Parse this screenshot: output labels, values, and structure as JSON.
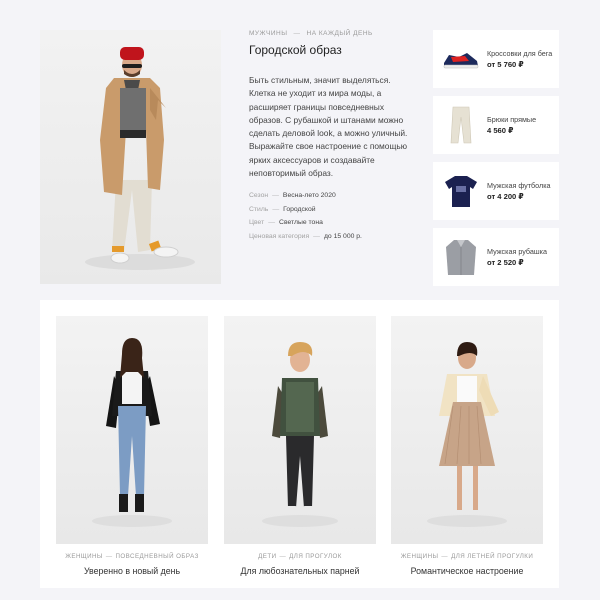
{
  "hero": {
    "category": "мужчины",
    "separator": "—",
    "tag": "на каждый день",
    "title": "Городской образ",
    "description": "Быть стильным, значит выделяться. Клетка не уходит из мира моды, а расширяет границы повседневных образов. С рубашкой и штанами можно сделать деловой look, а можно уличный. Выражайте свое настроение с помощью ярких аксессуаров и создавайте неповторимый образ.",
    "meta": [
      {
        "key": "Сезон",
        "dash": "—",
        "value": "Весна-лето 2020"
      },
      {
        "key": "Стиль",
        "dash": "—",
        "value": "Городской"
      },
      {
        "key": "Цвет",
        "dash": "—",
        "value": "Светлые тона"
      },
      {
        "key": "Ценовая категория",
        "dash": "—",
        "value": "до 15 000 р."
      }
    ]
  },
  "products": [
    {
      "name": "Кроссовки для бега",
      "price": "от 5 760 ₽",
      "icon": "sneaker-icon"
    },
    {
      "name": "Брюки прямые",
      "price": "4 560 ₽",
      "icon": "trousers-icon"
    },
    {
      "name": "Мужская футболка",
      "price": "от 4 200 ₽",
      "icon": "tshirt-icon"
    },
    {
      "name": "Мужская рубашка",
      "price": "от 2 520 ₽",
      "icon": "shirt-icon"
    }
  ],
  "looks": [
    {
      "category": "женщины",
      "separator": "—",
      "tag": "повседневный образ",
      "title": "Уверенно в новый день"
    },
    {
      "category": "дети",
      "separator": "—",
      "tag": "для прогулок",
      "title": "Для любознательных парней"
    },
    {
      "category": "женщины",
      "separator": "—",
      "tag": "для летней прогулки",
      "title": "Романтическое настроение"
    }
  ],
  "colors": {
    "background": "#f4f4f8",
    "card": "#ffffff",
    "muted": "#9a9a9a"
  }
}
